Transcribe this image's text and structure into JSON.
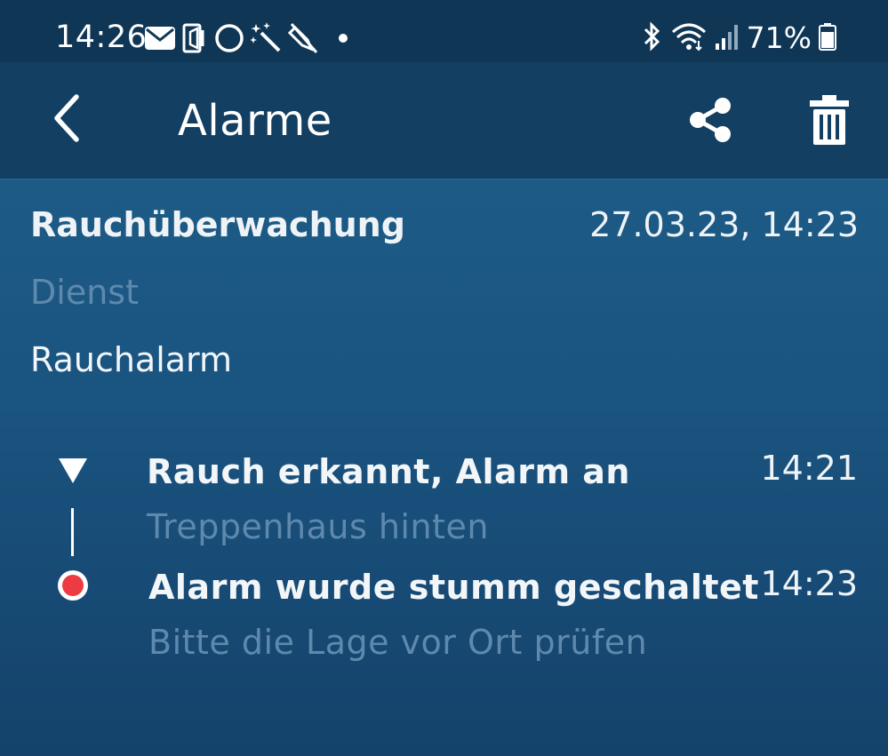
{
  "status_bar": {
    "time": "14:26",
    "battery_percent": "71%",
    "icons_left": [
      "mail-icon",
      "silent-mode-icon",
      "circle-icon",
      "magic-wand-icon",
      "mute-mic-icon",
      "dot-icon"
    ],
    "icons_right": [
      "bluetooth-icon",
      "wifi-icon",
      "signal-icon",
      "battery-icon"
    ]
  },
  "app_bar": {
    "title": "Alarme",
    "back_icon": "chevron-left-icon",
    "share_icon": "share-icon",
    "delete_icon": "trash-icon"
  },
  "alarm": {
    "title": "Rauchüberwachung",
    "datetime": "27.03.23, 14:23",
    "service_label": "Dienst",
    "type": "Rauchalarm"
  },
  "timeline": {
    "events": [
      {
        "title": "Rauch erkannt, Alarm an",
        "subtitle": "Treppenhaus hinten",
        "time": "14:21",
        "marker": "triangle-down-icon"
      },
      {
        "title": "Alarm wurde stumm geschaltet",
        "subtitle": "Bitte die Lage vor Ort prüfen",
        "time": "14:23",
        "marker": "red-dot-icon"
      }
    ]
  },
  "colors": {
    "status_bar_bg": "#0f3655",
    "app_bar_bg": "#123f62",
    "content_bg": "#1a5480",
    "muted_text": "#5e89ad",
    "alert_red": "#ee3a43"
  }
}
